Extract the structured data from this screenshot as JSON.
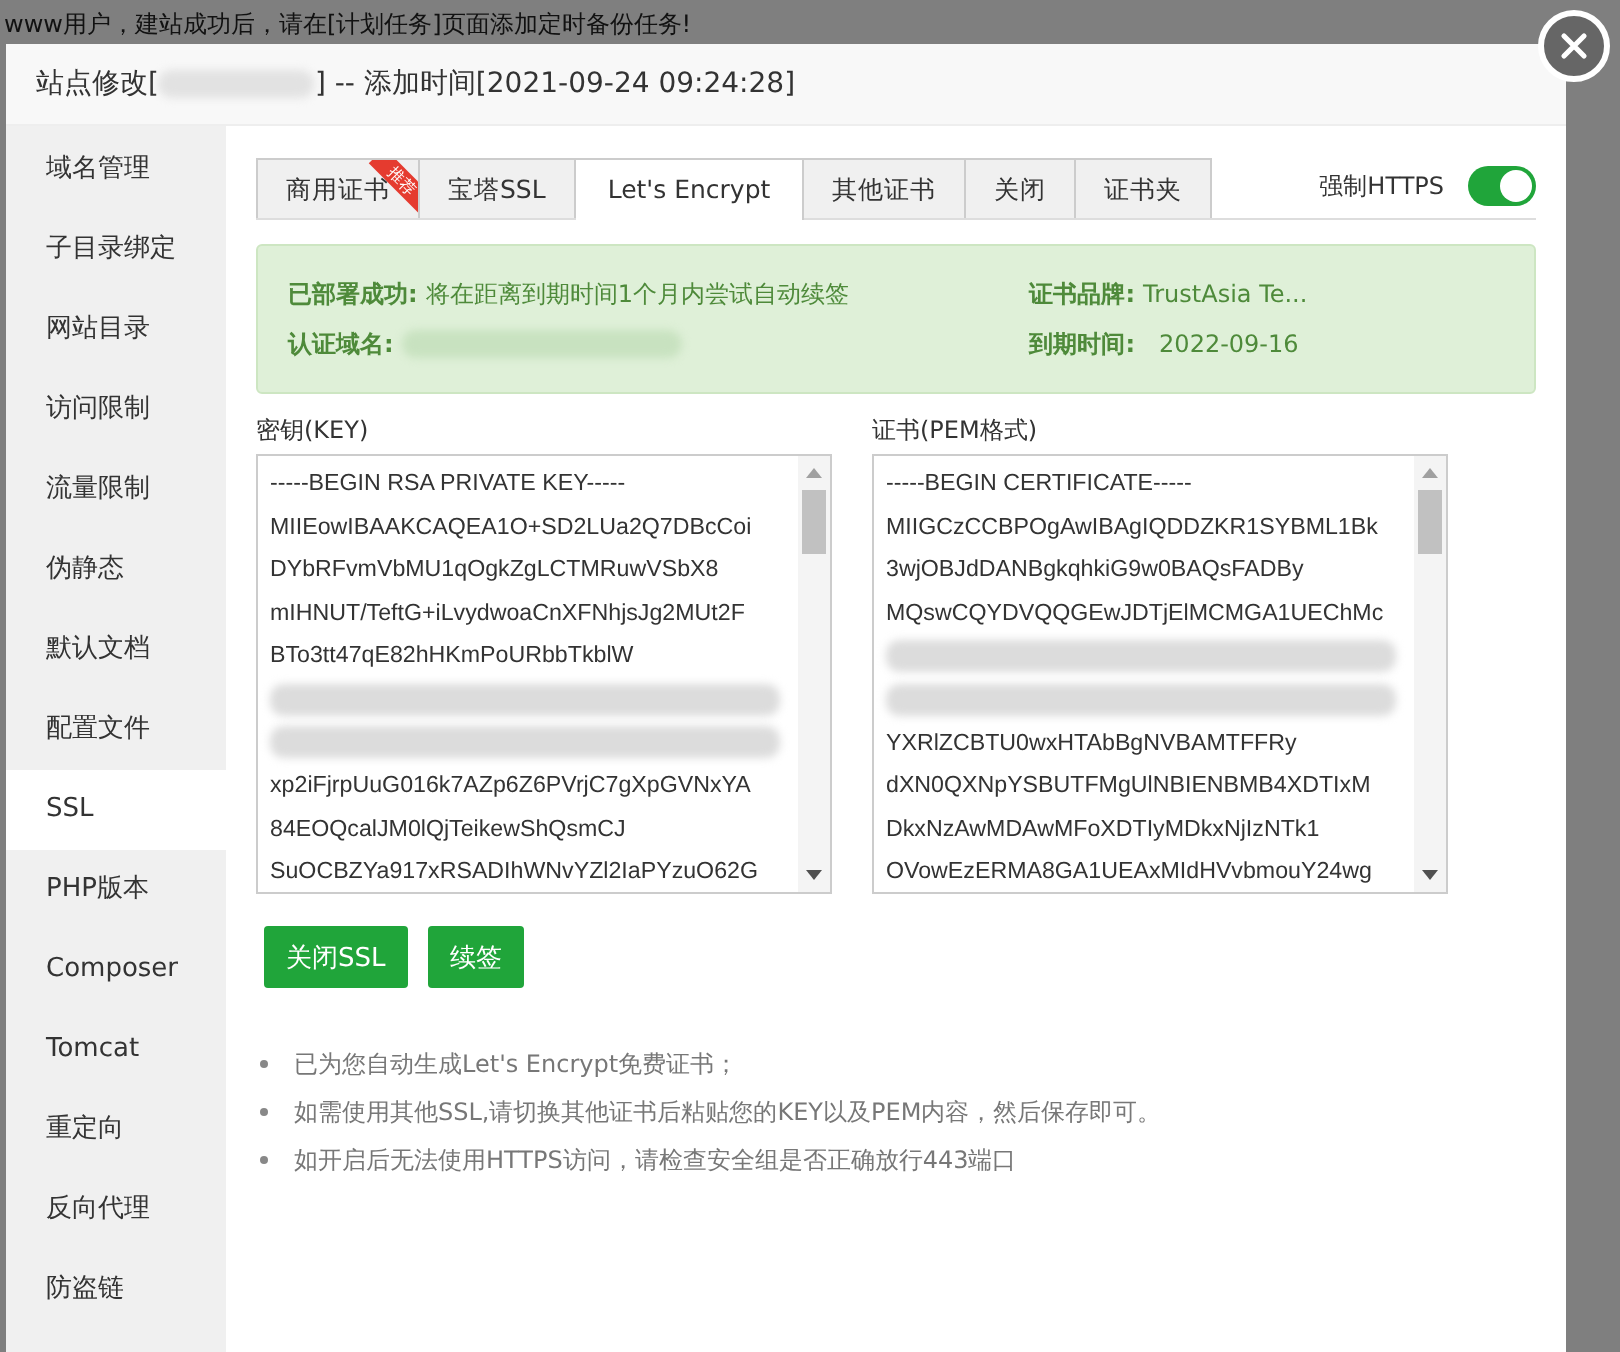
{
  "background_notice": "www用户，建站成功后，请在[计划任务]页面添加定时备份任务!",
  "dialog": {
    "title_prefix": "站点修改[",
    "title_suffix": "] -- 添加时间[2021-09-24 09:24:28]"
  },
  "sidebar": {
    "items": [
      {
        "label": "域名管理",
        "selected": false
      },
      {
        "label": "子目录绑定",
        "selected": false
      },
      {
        "label": "网站目录",
        "selected": false
      },
      {
        "label": "访问限制",
        "selected": false
      },
      {
        "label": "流量限制",
        "selected": false
      },
      {
        "label": "伪静态",
        "selected": false
      },
      {
        "label": "默认文档",
        "selected": false
      },
      {
        "label": "配置文件",
        "selected": false
      },
      {
        "label": "SSL",
        "selected": true
      },
      {
        "label": "PHP版本",
        "selected": false
      },
      {
        "label": "Composer",
        "selected": false
      },
      {
        "label": "Tomcat",
        "selected": false
      },
      {
        "label": "重定向",
        "selected": false
      },
      {
        "label": "反向代理",
        "selected": false
      },
      {
        "label": "防盗链",
        "selected": false
      }
    ]
  },
  "tabs": [
    {
      "label": "商用证书",
      "selected": false,
      "ribbon": "推荐"
    },
    {
      "label": "宝塔SSL",
      "selected": false
    },
    {
      "label": "Let's Encrypt",
      "selected": true
    },
    {
      "label": "其他证书",
      "selected": false
    },
    {
      "label": "关闭",
      "selected": false
    },
    {
      "label": "证书夹",
      "selected": false
    }
  ],
  "force_https": {
    "label": "强制HTTPS",
    "on": true
  },
  "status": {
    "deployed_label": "已部署成功:",
    "deployed_text": "将在距离到期时间1个月内尝试自动续签",
    "domain_label": "认证域名:",
    "brand_label": "证书品牌:",
    "brand": "TrustAsia Te...",
    "expiry_label": "到期时间:",
    "expiry": "2022-09-16"
  },
  "key": {
    "label": "密钥(KEY)",
    "lines": [
      {
        "kind": "line",
        "text": "-----BEGIN RSA PRIVATE KEY-----"
      },
      {
        "kind": "line",
        "text": "MIIEowIBAAKCAQEA1O+SD2LUa2Q7DBcCoi"
      },
      {
        "kind": "line",
        "text": "DYbRFvmVbMU1qOgkZgLCTMRuwVSbX8"
      },
      {
        "kind": "line",
        "text": "mIHNUT/TeftG+iLvydwoaCnXFNhjsJg2MUt2F"
      },
      {
        "kind": "line",
        "text": "BTo3tt47qE82hHKmPoURbbTkblW"
      },
      {
        "kind": "blurred"
      },
      {
        "kind": "blurred"
      },
      {
        "kind": "line",
        "text": "xp2iFjrpUuG016k7AZp6Z6PVrjC7gXpGVNxYA"
      },
      {
        "kind": "line",
        "text": "84EOQcalJM0lQjTeikewShQsmCJ"
      },
      {
        "kind": "line",
        "text": "SuOCBZYa917xRSADIhWNvYZl2IaPYzuO62G"
      }
    ]
  },
  "cert": {
    "label": "证书(PEM格式)",
    "lines": [
      {
        "kind": "line",
        "text": "-----BEGIN CERTIFICATE-----"
      },
      {
        "kind": "line",
        "text": "MIIGCzCCBPOgAwIBAgIQDDZKR1SYBML1Bk"
      },
      {
        "kind": "line",
        "text": "3wjOBJdDANBgkqhkiG9w0BAQsFADBy"
      },
      {
        "kind": "line",
        "text": "MQswCQYDVQQGEwJDTjElMCMGA1UEChMc"
      },
      {
        "kind": "blurred"
      },
      {
        "kind": "blurred"
      },
      {
        "kind": "line",
        "text": "YXRlZCBTU0wxHTAbBgNVBAMTFFRy"
      },
      {
        "kind": "line",
        "text": "dXN0QXNpYSBUTFMgUlNBIENBMB4XDTIxM"
      },
      {
        "kind": "line",
        "text": "DkxNzAwMDAwMFoXDTIyMDkxNjIzNTk1"
      },
      {
        "kind": "line",
        "text": "OVowEzERMA8GA1UEAxMIdHVvbmouY24wg"
      }
    ]
  },
  "buttons": [
    "关闭SSL",
    "续签"
  ],
  "notes": [
    "已为您自动生成Let's Encrypt免费证书；",
    "如需使用其他SSL,请切换其他证书后粘贴您的KEY以及PEM内容，然后保存即可。",
    "如开启后无法使用HTTPS访问，请检查安全组是否正确放行443端口"
  ]
}
